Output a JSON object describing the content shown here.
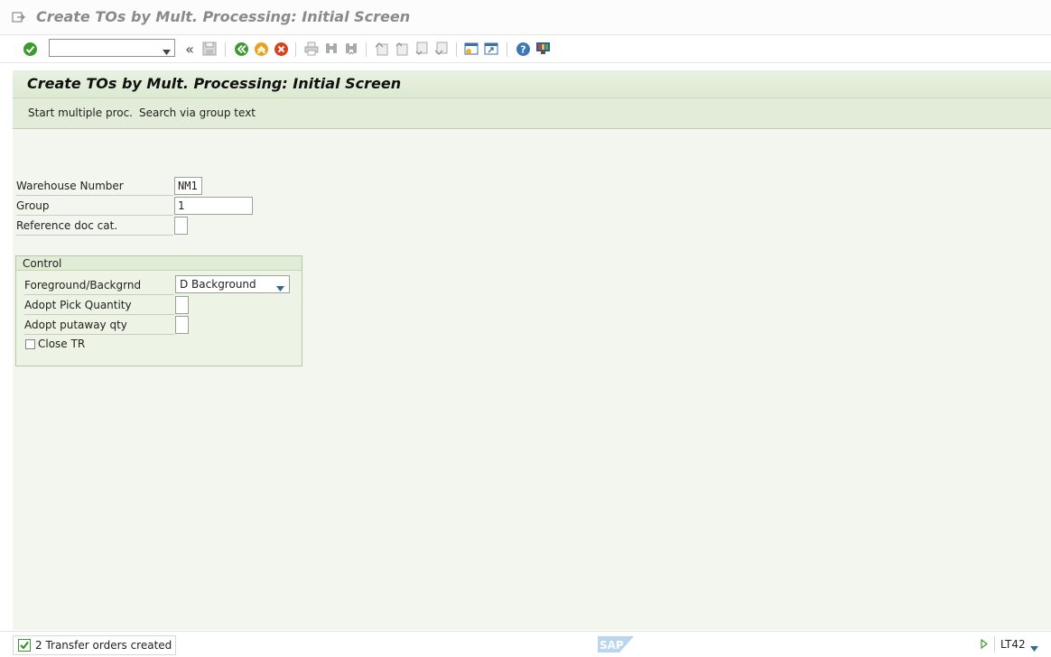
{
  "window": {
    "title": "Create TOs by Mult. Processing: Initial Screen"
  },
  "toolbar": {
    "command_value": "",
    "back_glyph": "«",
    "icons": [
      "enter-icon",
      "save-icon",
      "back-icon",
      "exit-icon",
      "cancel-icon",
      "print-icon",
      "find-icon",
      "find-next-icon",
      "first-page-icon",
      "previous-page-icon",
      "next-page-icon",
      "last-page-icon",
      "create-session-icon",
      "shortcut-icon",
      "help-icon",
      "customize-layout-icon"
    ]
  },
  "header": {
    "title": "Create TOs by Mult. Processing: Initial Screen",
    "buttons": {
      "start": "Start multiple proc.",
      "search": "Search via group text"
    }
  },
  "form": {
    "warehouse_label": "Warehouse Number",
    "warehouse_value": "NM1",
    "group_label": "Group",
    "group_value": "1",
    "refdoc_label": "Reference doc cat.",
    "refdoc_value": ""
  },
  "control": {
    "title": "Control",
    "fg_label": "Foreground/Backgrnd",
    "fg_value": "D Background",
    "pick_label": "Adopt Pick Quantity",
    "pick_value": "",
    "putaway_label": "Adopt putaway qty",
    "putaway_value": "",
    "close_tr_label": "Close TR",
    "close_tr_checked": false
  },
  "status": {
    "message": "2 Transfer orders created",
    "transaction": "LT42"
  },
  "colors": {
    "background": "#f2f6ee",
    "header": "#e2ecd8",
    "ok_green": "#3d9a2f",
    "cancel_red": "#d9431c",
    "exit_orange": "#e9a21c"
  }
}
